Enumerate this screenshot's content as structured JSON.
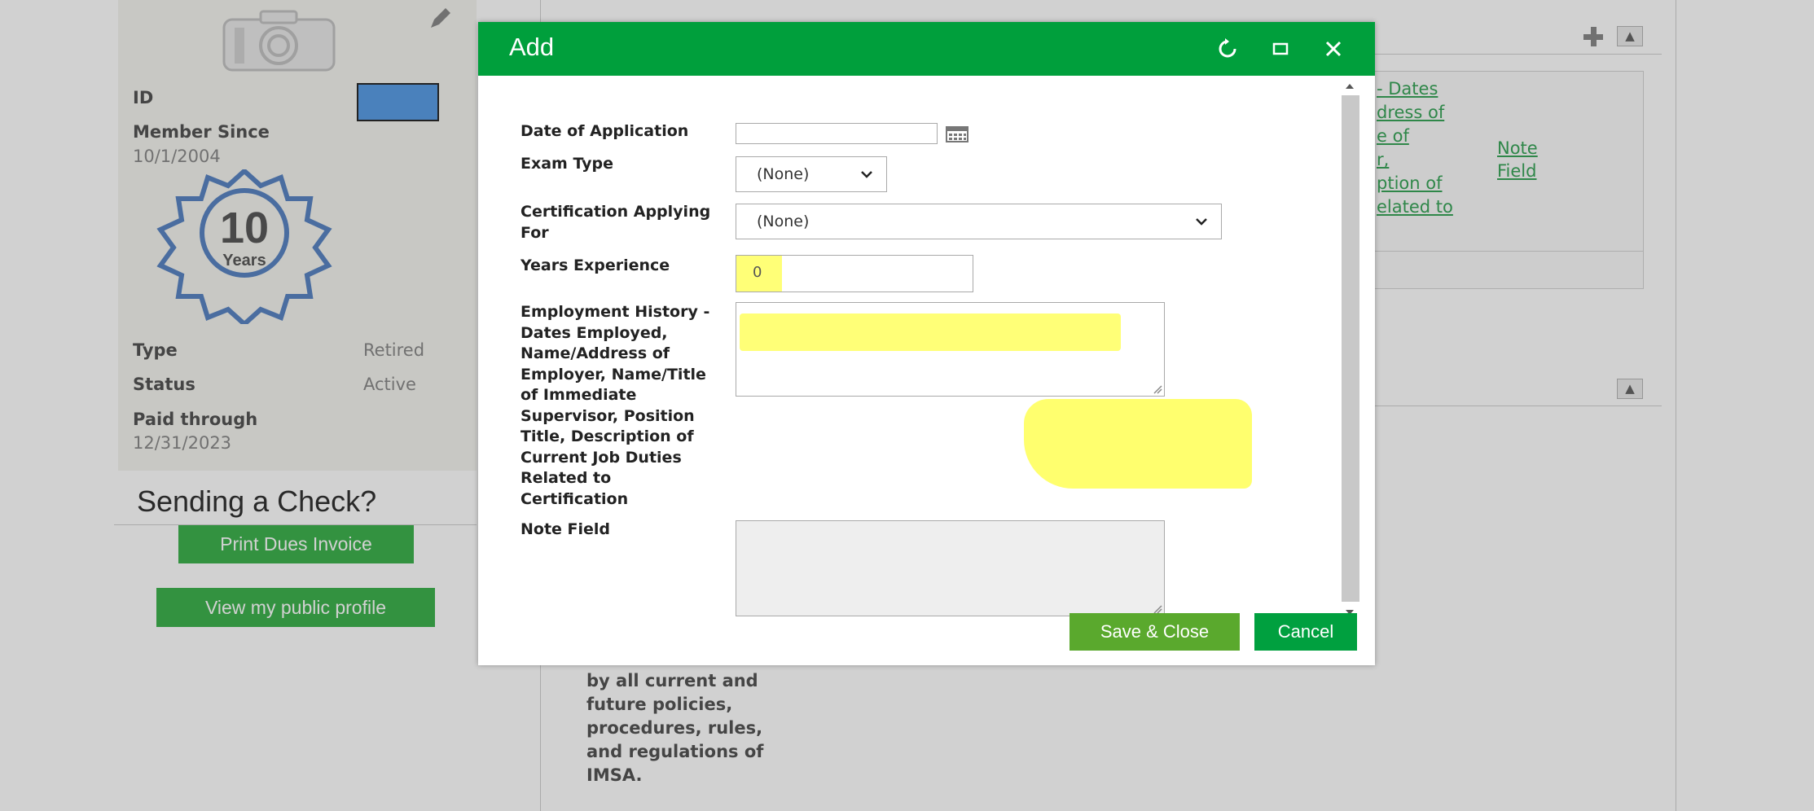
{
  "profile": {
    "id_label": "ID",
    "member_since_label": "Member Since",
    "member_since_value": "10/1/2004",
    "badge_number": "10",
    "badge_caption": "Years",
    "type_label": "Type",
    "type_value": "Retired",
    "status_label": "Status",
    "status_value": "Active",
    "paid_through_label": "Paid through",
    "paid_through_value": "12/31/2023",
    "sending_check_heading": "Sending a Check?",
    "print_invoice_label": "Print Dues Invoice",
    "public_profile_label": "View my public profile"
  },
  "background": {
    "link_fragments": [
      "- Dates",
      "dress of",
      "e of",
      "r,",
      "ption of",
      "elated to"
    ],
    "note_link": [
      "Note",
      "Field"
    ],
    "agreement_lines": [
      "by all current and",
      "future policies,",
      "procedures, rules,",
      "and regulations of",
      "IMSA."
    ]
  },
  "dialog": {
    "title": "Add",
    "fields": {
      "date_of_application": {
        "label": "Date of Application",
        "value": ""
      },
      "exam_type": {
        "label": "Exam Type",
        "value": "(None)"
      },
      "certification": {
        "label": "Certification Applying For",
        "value": "(None)"
      },
      "years_experience": {
        "label": "Years Experience",
        "value": "0"
      },
      "employment_history": {
        "label": "Employment History - Dates Employed, Name/Address of Employer, Name/Title of Immediate Supervisor, Position Title, Description of Current Job Duties Related to Certification",
        "value": ""
      },
      "note_field": {
        "label": "Note Field",
        "value": ""
      }
    },
    "save_label": "Save & Close",
    "cancel_label": "Cancel"
  },
  "colors": {
    "header_green": "#009f3c",
    "save_green": "#5aa92d",
    "highlight_yellow": "#ffff4a"
  },
  "icons": [
    "camera-icon",
    "pencil-icon",
    "badge-icon",
    "refresh-icon",
    "maximize-icon",
    "close-icon",
    "calendar-icon",
    "chevron-down-icon",
    "plus-icon",
    "collapse-up-icon"
  ]
}
